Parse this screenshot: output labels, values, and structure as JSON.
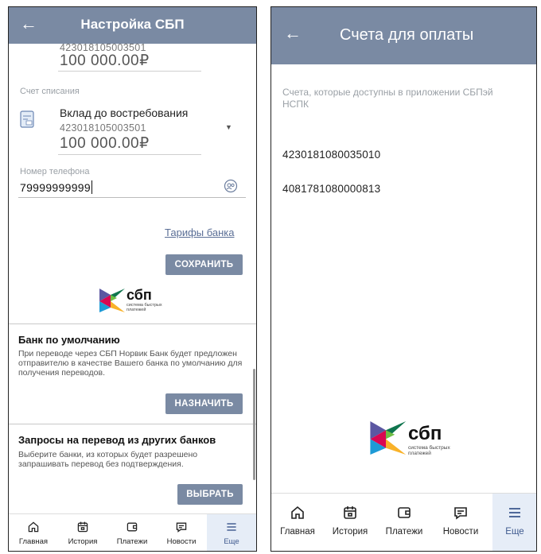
{
  "left": {
    "title": "Настройка СБП",
    "top_account": {
      "number": "423018105003501",
      "amount": "100 000.00₽"
    },
    "debit_label": "Счет списания",
    "debit_account": {
      "name": "Вклад до востребования",
      "number": "423018105003501",
      "amount": "100 000.00₽"
    },
    "phone_label": "Номер телефона",
    "phone_value": "79999999999",
    "tariffs_link": "Тарифы банка",
    "save_button": "СОХРАНИТЬ",
    "sbp_logo": {
      "brand": "сбп",
      "subtitle_line1": "система быстрых",
      "subtitle_line2": "платежей"
    },
    "default_bank": {
      "title": "Банк по умолчанию",
      "description": "При переводе через СБП Норвик Банк будет предложен отправителю в качестве Вашего банка по умолчанию для получения переводов.",
      "button": "НАЗНАЧИТЬ"
    },
    "requests": {
      "title": "Запросы на перевод из других банков",
      "description": "Выберите банки, из которых будет разрешено запрашивать перевод без подтверждения.",
      "button": "ВЫБРАТЬ"
    }
  },
  "right": {
    "title": "Счета для оплаты",
    "description": "Счета, которые доступны в приложении СБПэй НСПК",
    "accounts": [
      "4230181080035010",
      "4081781080000813"
    ],
    "sbp_logo": {
      "brand": "сбп",
      "subtitle_line1": "система быстрых",
      "subtitle_line2": "платежей"
    }
  },
  "nav": {
    "items": [
      {
        "label": "Главная",
        "icon": "home-icon"
      },
      {
        "label": "История",
        "icon": "history-icon"
      },
      {
        "label": "Платежи",
        "icon": "wallet-icon"
      },
      {
        "label": "Новости",
        "icon": "news-icon"
      },
      {
        "label": "Еще",
        "icon": "menu-icon",
        "active": true
      }
    ]
  },
  "colors": {
    "appbar": "#7a8aa3",
    "active_nav": "#3f5a8f",
    "active_nav_bg": "#e6edf7",
    "link": "#5b6f96"
  }
}
